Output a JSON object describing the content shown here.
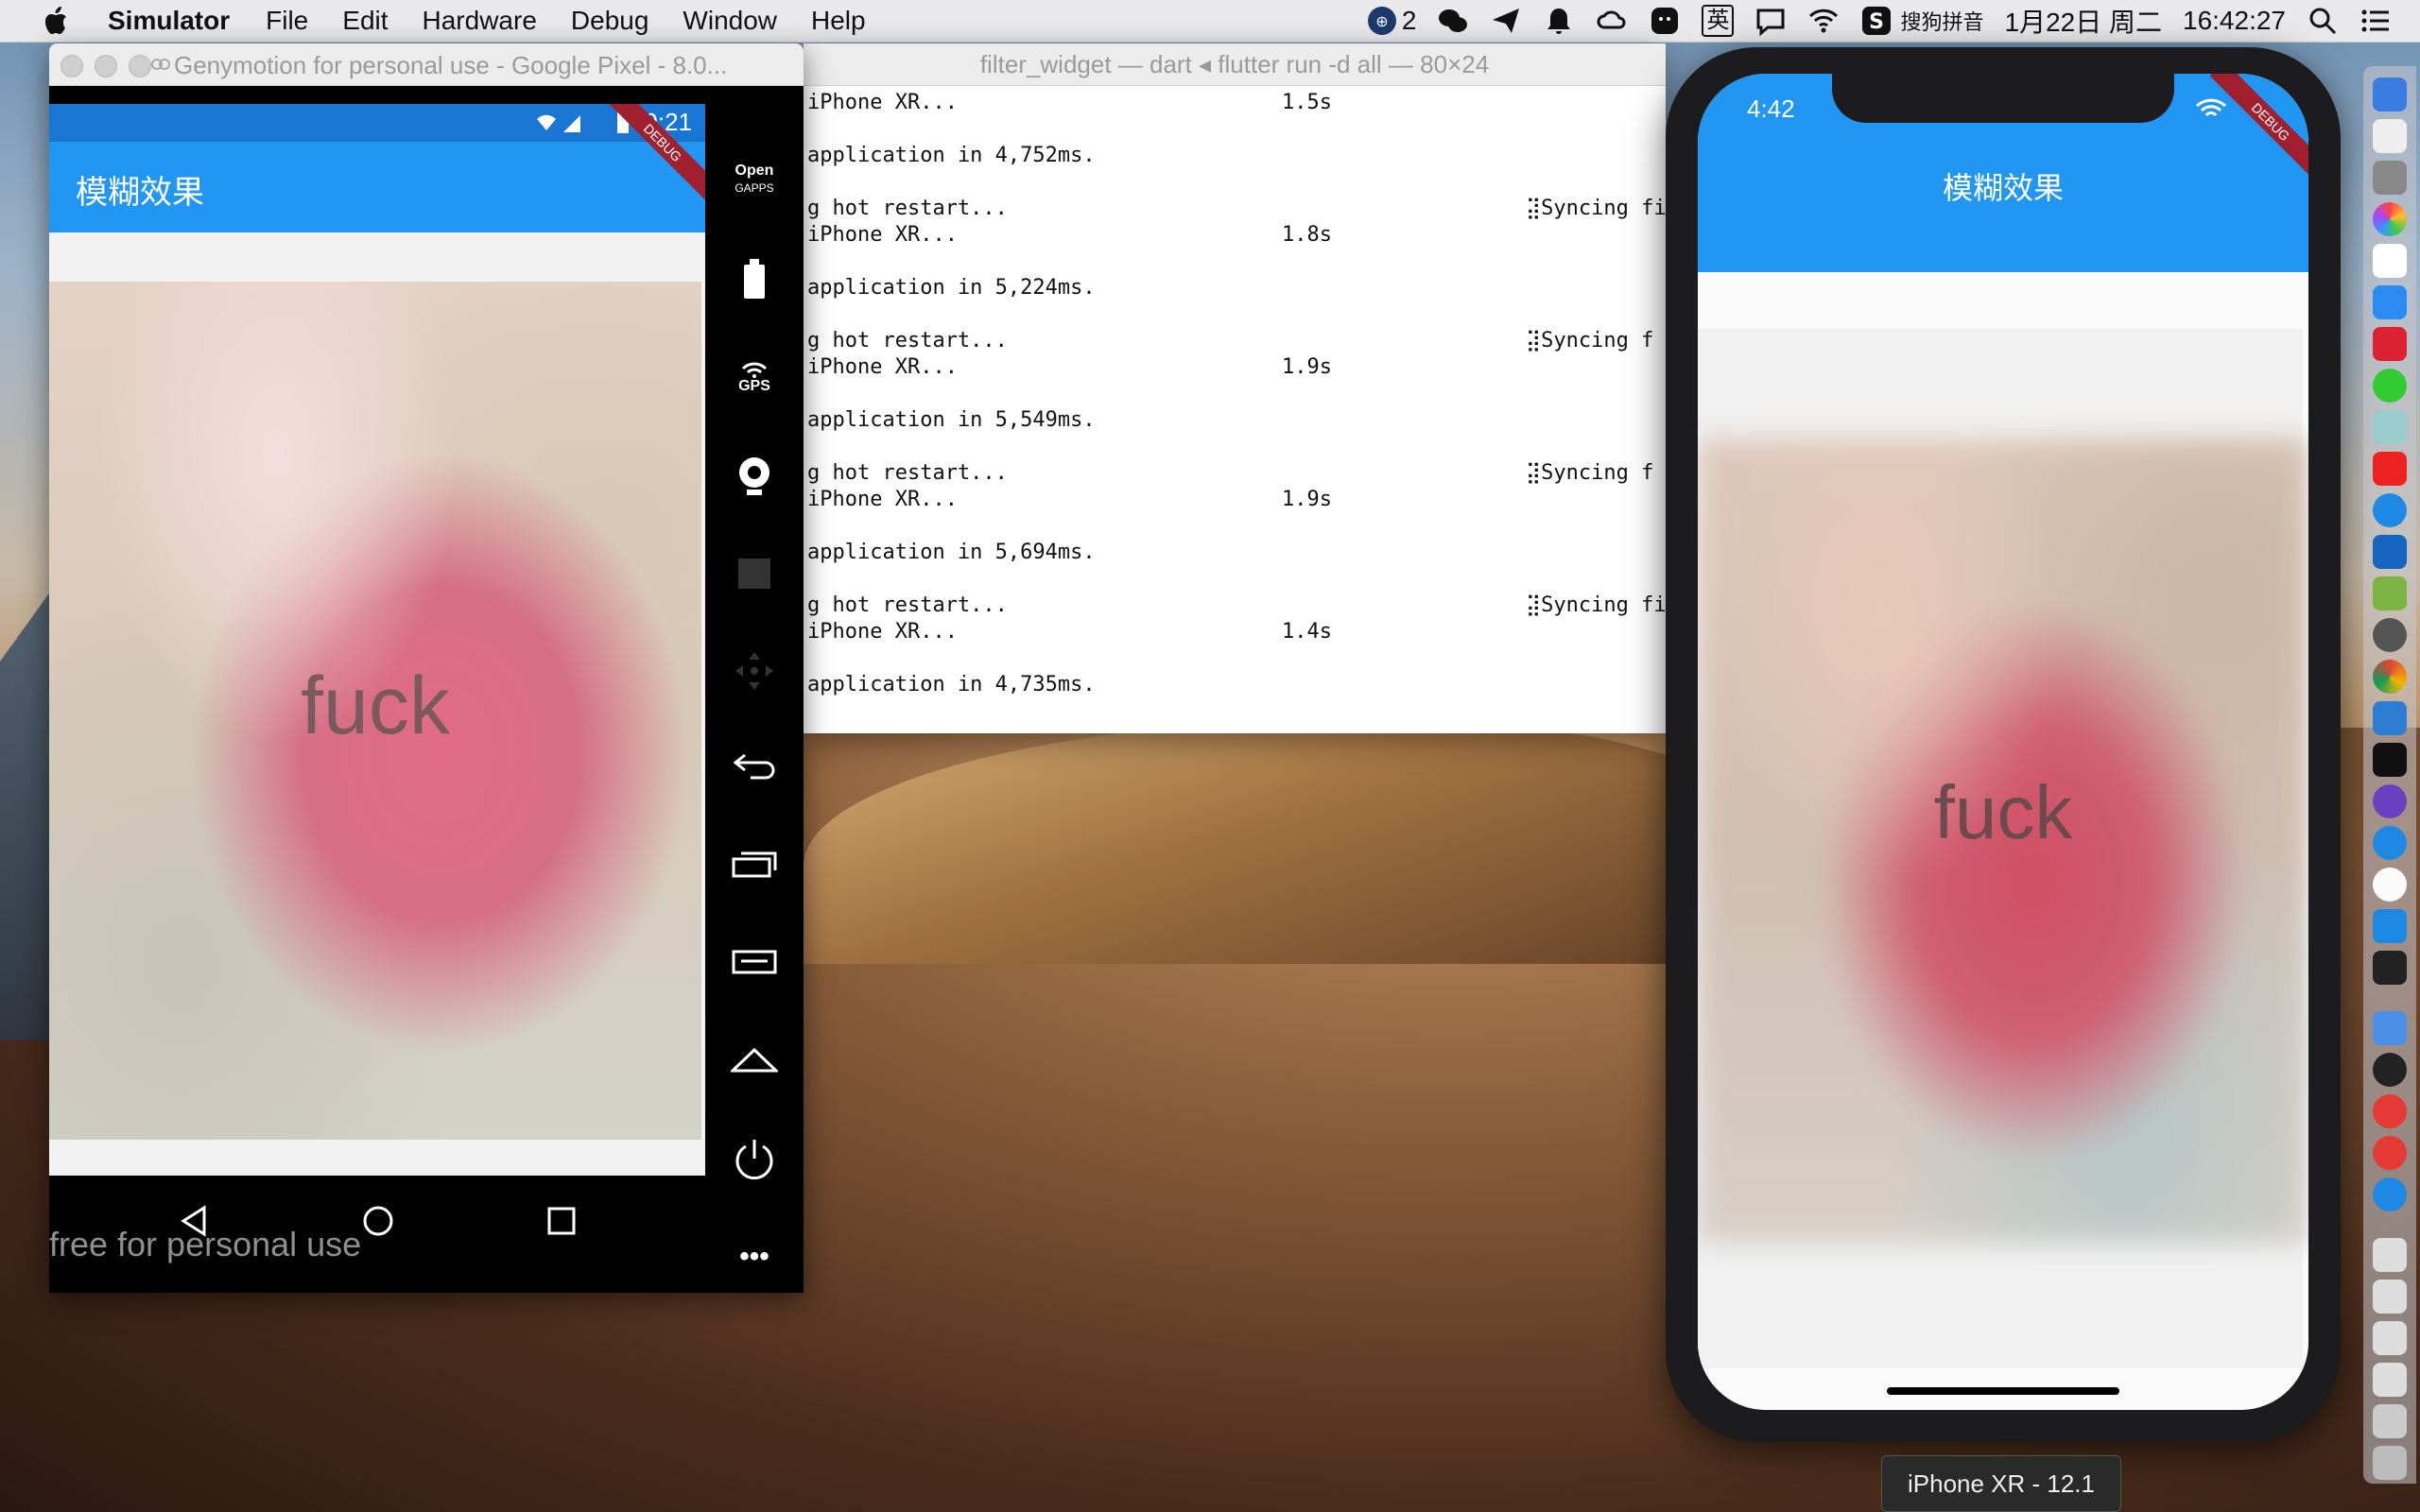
{
  "menubar": {
    "app_name": "Simulator",
    "items": [
      "File",
      "Edit",
      "Hardware",
      "Debug",
      "Window",
      "Help"
    ],
    "status": {
      "notification_count": "2",
      "input_method": "搜狗拼音",
      "ime_char": "英",
      "date": "1月22日 周二",
      "time": "16:42:27"
    }
  },
  "genymotion": {
    "title": "Genymotion for personal use - Google Pixel - 8.0...",
    "status_time": "9:21",
    "debug_label": "DEBUG",
    "appbar_title": "模糊效果",
    "overlay_text": "fuck",
    "watermark": "free for personal use",
    "sidebar": {
      "opengapps_top": "Open",
      "opengapps_bottom": "GAPPS",
      "gps": "GPS",
      "more": "•••"
    }
  },
  "terminal": {
    "title": "filter_widget — dart ◂ flutter run -d all — 80×24",
    "lines": [
      {
        "left": "iPhone XR...",
        "time": "1.5s",
        "right": ""
      },
      {
        "left": "application in 4,752ms.",
        "time": "",
        "right": ""
      },
      {
        "left": "g hot restart...",
        "time": "",
        "right": "⣽Syncing fi"
      },
      {
        "left": "iPhone XR...",
        "time": "1.8s",
        "right": ""
      },
      {
        "left": "application in 5,224ms.",
        "time": "",
        "right": ""
      },
      {
        "left": "g hot restart...",
        "time": "",
        "right": "⣽Syncing f"
      },
      {
        "left": "iPhone XR...",
        "time": "1.9s",
        "right": ""
      },
      {
        "left": "application in 5,549ms.",
        "time": "",
        "right": ""
      },
      {
        "left": "g hot restart...",
        "time": "",
        "right": "⣽Syncing f"
      },
      {
        "left": "iPhone XR...",
        "time": "1.9s",
        "right": ""
      },
      {
        "left": "application in 5,694ms.",
        "time": "",
        "right": ""
      },
      {
        "left": "g hot restart...",
        "time": "",
        "right": "⣽Syncing fi"
      },
      {
        "left": "iPhone XR...",
        "time": "1.4s",
        "right": ""
      },
      {
        "left": "application in 4,735ms.",
        "time": "",
        "right": ""
      }
    ]
  },
  "iphone": {
    "status_time": "4:42",
    "debug_label": "DEBUG",
    "appbar_title": "模糊效果",
    "overlay_text": "fuck",
    "device_label": "iPhone XR - 12.1"
  },
  "colors": {
    "flutter_blue": "#2196f3",
    "debug_banner": "#a02030"
  }
}
